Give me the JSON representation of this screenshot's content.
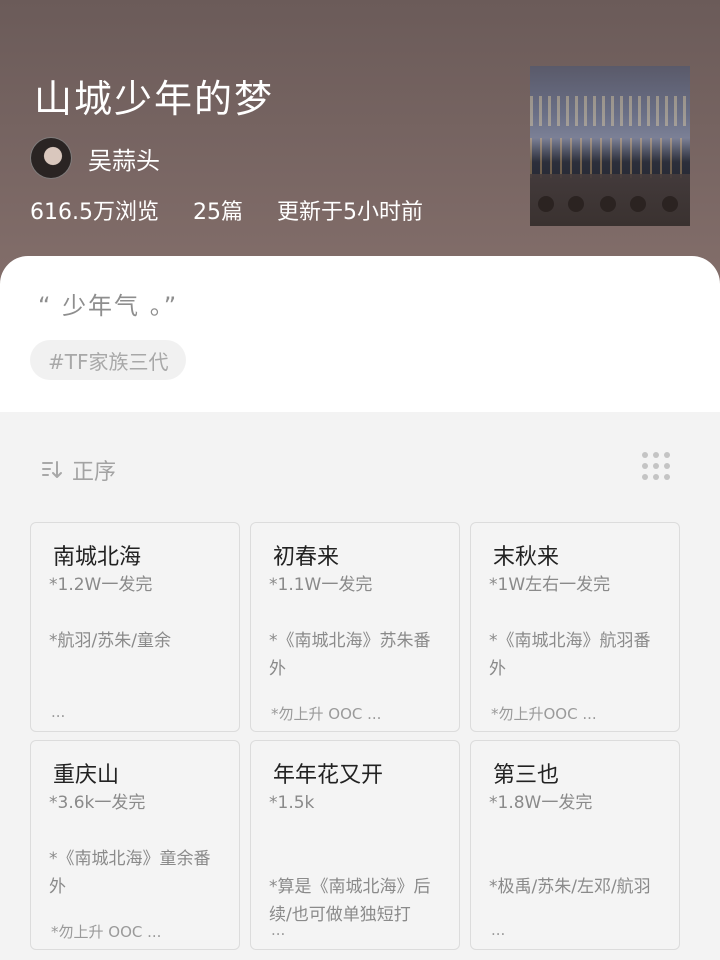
{
  "header": {
    "title": "山城少年的梦",
    "author": "吴蒜头",
    "stats": {
      "views": "616.5万浏览",
      "chapters": "25篇",
      "updated": "更新于5小时前"
    }
  },
  "intro": {
    "quote": "“ 少年气 。”",
    "tag": "#TF家族三代"
  },
  "sort": {
    "label": "正序"
  },
  "chapters": [
    {
      "title": "南城北海",
      "body": "*1.2W一发完\n\n*航羽/苏朱/童余",
      "more": "..."
    },
    {
      "title": "初春来",
      "body": "*1.1W一发完\n\n*《南城北海》苏朱番外",
      "more": "*勿上升 OOC ..."
    },
    {
      "title": "末秋来",
      "body": "*1W左右一发完\n\n*《南城北海》航羽番外",
      "more": "*勿上升OOC ..."
    },
    {
      "title": "重庆山",
      "body": "*3.6k一发完\n\n*《南城北海》童余番外",
      "more": "*勿上升 OOC ..."
    },
    {
      "title": "年年花又开",
      "body": "*1.5k\n\n\n*算是《南城北海》后续/也可做单独短打",
      "more": "..."
    },
    {
      "title": "第三也",
      "body": "*1.8W一发完\n\n\n*极禹/苏朱/左邓/航羽",
      "more": "..."
    }
  ]
}
